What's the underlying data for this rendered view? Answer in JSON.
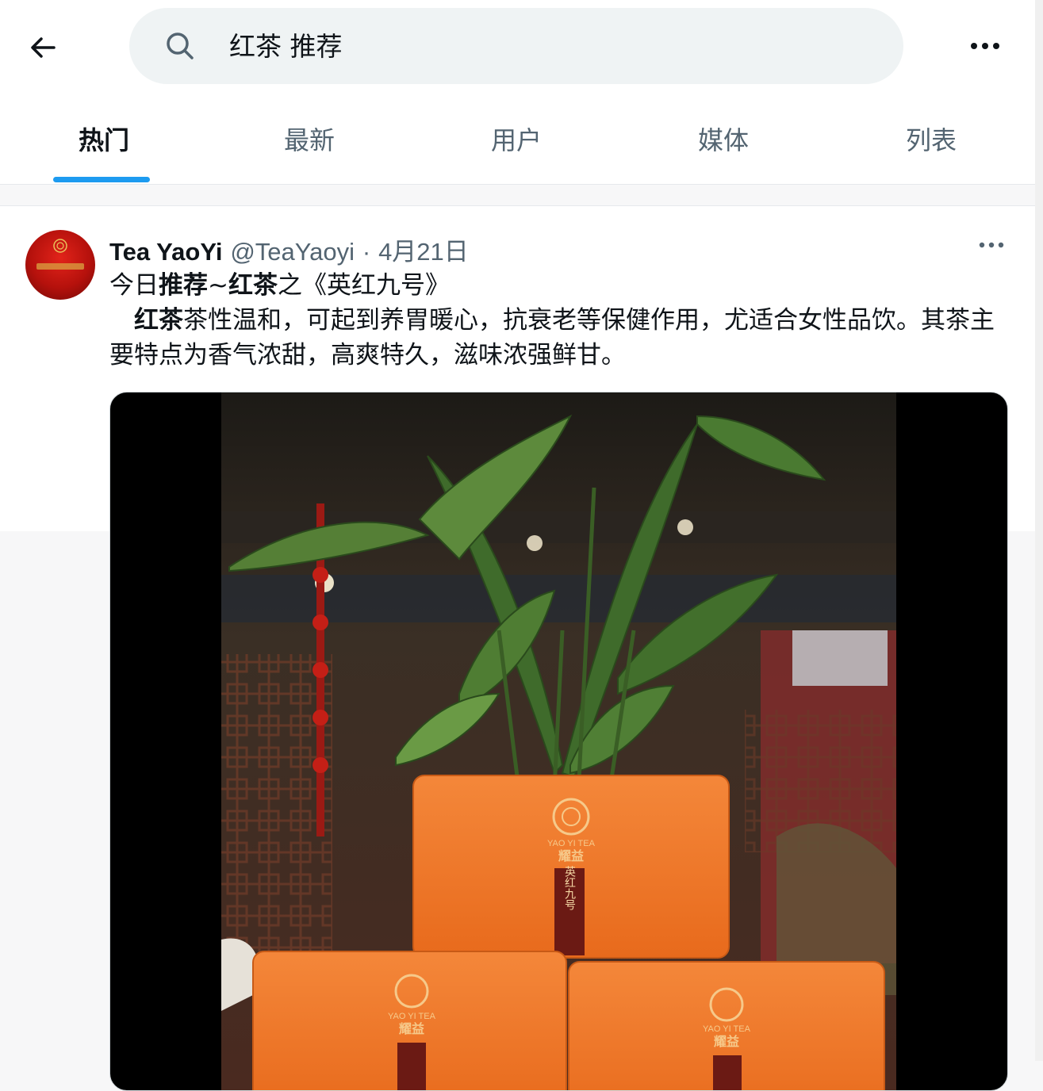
{
  "search": {
    "query": "红茶 推荐"
  },
  "tabs": [
    {
      "label": "热门",
      "active": true
    },
    {
      "label": "最新",
      "active": false
    },
    {
      "label": "用户",
      "active": false
    },
    {
      "label": "媒体",
      "active": false
    },
    {
      "label": "列表",
      "active": false
    }
  ],
  "tweet": {
    "author_name": "Tea YaoYi",
    "handle": "@TeaYaoyi",
    "separator": "·",
    "date": "4月21日",
    "line1": {
      "pre": "今日",
      "bold1": "推荐",
      "mid": "~",
      "bold2": "红茶",
      "post": "之《英红九号》"
    },
    "line2": {
      "indent": "　",
      "bold": "红茶",
      "rest": "茶性温和，可起到养胃暖心，抗衰老等保健作用，尤适合女性品饮。其茶主要特点为香气浓甜，高爽特久，滋味浓强鲜甘。"
    },
    "media": {
      "box_brand_en": "YAO YI TEA",
      "box_brand_cn": "耀益",
      "box_product": "英红九号"
    }
  },
  "colors": {
    "accent": "#1d9bf0",
    "search_bg": "#eff3f4",
    "secondary_text": "#536471",
    "tea_box_orange": "#f07a28"
  },
  "icons": [
    "back-arrow-icon",
    "search-icon",
    "more-icon",
    "tweet-more-icon"
  ]
}
